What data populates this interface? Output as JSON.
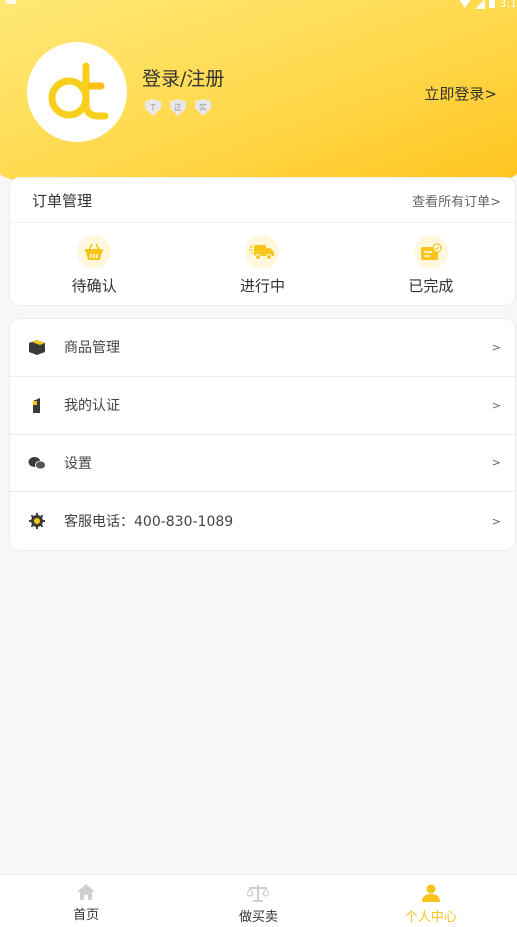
{
  "status_bar": {
    "time": "3:1"
  },
  "profile": {
    "title": "登录/注册",
    "login_link": "立即登录>",
    "badges": [
      {
        "icon": "shield-t-icon",
        "glyph": "T"
      },
      {
        "icon": "shield-zheng-icon",
        "glyph": "正"
      },
      {
        "icon": "shield-shi-icon",
        "glyph": "实"
      }
    ]
  },
  "orders": {
    "title": "订单管理",
    "view_all": "查看所有订单>",
    "items": [
      {
        "label": "待确认",
        "icon": "basket-icon"
      },
      {
        "label": "进行中",
        "icon": "delivery-truck-icon"
      },
      {
        "label": "已完成",
        "icon": "completed-card-icon"
      }
    ]
  },
  "menu": {
    "items": [
      {
        "label": "商品管理",
        "icon": "box-icon",
        "arrow": ">"
      },
      {
        "label": "我的认证",
        "icon": "certificate-icon",
        "arrow": ">"
      },
      {
        "label": "设置",
        "icon": "chat-bubbles-icon",
        "arrow": ">"
      },
      {
        "label": "客服电话：400-830-1089",
        "icon": "gear-icon",
        "arrow": ">"
      }
    ]
  },
  "tabbar": {
    "items": [
      {
        "label": "首页",
        "icon": "home-icon",
        "active": false
      },
      {
        "label": "做买卖",
        "icon": "scale-icon",
        "active": false
      },
      {
        "label": "个人中心",
        "icon": "user-icon",
        "active": true
      }
    ]
  },
  "colors": {
    "accent": "#ffd02a",
    "active_tab": "#f8c31c"
  }
}
